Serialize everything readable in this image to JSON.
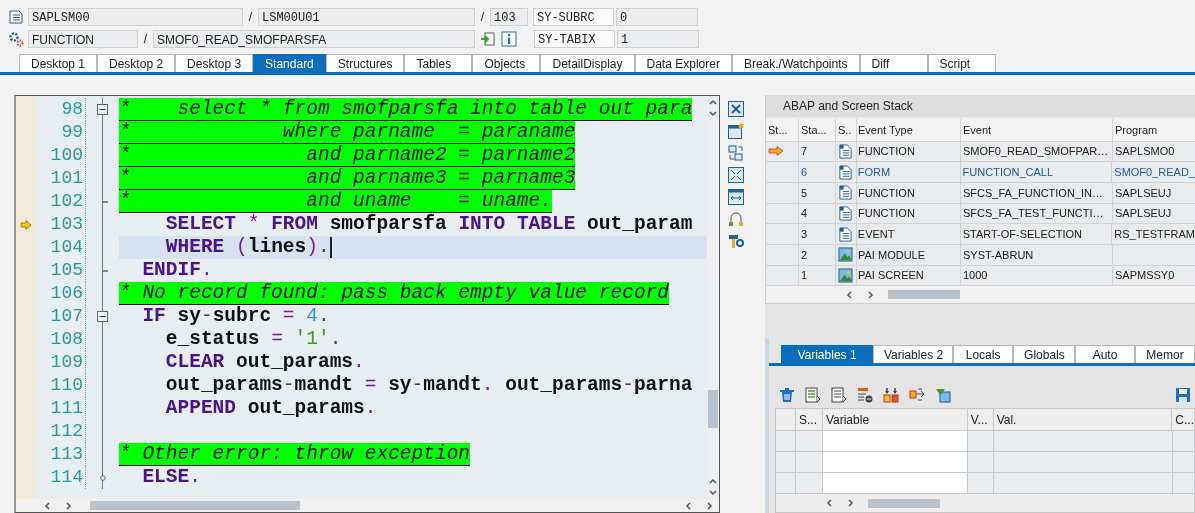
{
  "header": {
    "row1": {
      "program": "SAPLSM00",
      "sep1": "/",
      "include": "LSM00U01",
      "sep2": "/",
      "line": "103",
      "sys_field": "SY-SUBRC",
      "sys_value": "0"
    },
    "row2": {
      "block_type": "FUNCTION",
      "sep1": "/",
      "block_name": "SMOF0_READ_SMOFPARSFA",
      "sys_field": "SY-TABIX",
      "sys_value": "1"
    }
  },
  "desktop_tabs": [
    {
      "label": "Desktop 1",
      "selected": false
    },
    {
      "label": "Desktop 2",
      "selected": false
    },
    {
      "label": "Desktop 3",
      "selected": false
    },
    {
      "label": "Standard",
      "selected": true
    },
    {
      "label": "Structures",
      "selected": false
    },
    {
      "label": "Tables",
      "selected": false
    },
    {
      "label": "Objects",
      "selected": false
    },
    {
      "label": "DetailDisplay",
      "selected": false
    },
    {
      "label": "Data Explorer",
      "selected": false
    },
    {
      "label": "Break./Watchpoints",
      "selected": false
    },
    {
      "label": "Diff",
      "selected": false
    },
    {
      "label": "Script",
      "selected": false
    }
  ],
  "code": {
    "lines": [
      {
        "number": "98",
        "kind": "comment",
        "text": "*    select * from smofparsfa into table out para",
        "fold": {
          "kind": "start"
        },
        "current": false,
        "cursor": false
      },
      {
        "number": "99",
        "kind": "comment",
        "text": "*             where parname  = paraname",
        "current": false,
        "cursor": false
      },
      {
        "number": "100",
        "kind": "comment",
        "text": "*               and parname2 = parname2",
        "current": false,
        "cursor": false
      },
      {
        "number": "101",
        "kind": "comment",
        "text": "*               and parname3 = parname3",
        "current": false,
        "cursor": false
      },
      {
        "number": "102",
        "kind": "comment",
        "text": "*               and uname    = uname.",
        "fold": {
          "kind": "end"
        },
        "current": false,
        "cursor": false
      },
      {
        "number": "103",
        "kind": "code",
        "tokens": [
          {
            "kind": "keyword",
            "text": "    SELECT"
          },
          {
            "kind": "operator",
            "text": " * "
          },
          {
            "kind": "keyword",
            "text": "FROM"
          },
          {
            "kind": "identifier",
            "text": " smofparsfa "
          },
          {
            "kind": "keyword",
            "text": "INTO TABLE"
          },
          {
            "kind": "identifier",
            "text": " out_param"
          }
        ],
        "current": true,
        "cursor": false
      },
      {
        "number": "104",
        "kind": "code",
        "tokens": [
          {
            "kind": "keyword",
            "text": "    WHERE"
          },
          {
            "kind": "operator",
            "text": " ("
          },
          {
            "kind": "identifier",
            "text": "lines"
          },
          {
            "kind": "operator",
            "text": ")."
          }
        ],
        "current": false,
        "cursor": true
      },
      {
        "number": "105",
        "kind": "code",
        "tokens": [
          {
            "kind": "keyword",
            "text": "  ENDIF"
          },
          {
            "kind": "operator",
            "text": "."
          }
        ],
        "fold": {
          "kind": "end"
        },
        "current": false,
        "cursor": false
      },
      {
        "number": "106",
        "kind": "comment",
        "text": "* No record found: pass back empty value record",
        "current": false,
        "cursor": false
      },
      {
        "number": "107",
        "kind": "code",
        "tokens": [
          {
            "kind": "keyword",
            "text": "  IF"
          },
          {
            "kind": "identifier",
            "text": " sy"
          },
          {
            "kind": "operator",
            "text": "-"
          },
          {
            "kind": "identifier",
            "text": "subrc"
          },
          {
            "kind": "operator",
            "text": " = "
          },
          {
            "kind": "number",
            "text": "4"
          },
          {
            "kind": "operator",
            "text": "."
          }
        ],
        "fold": {
          "kind": "start"
        },
        "current": false,
        "cursor": false
      },
      {
        "number": "108",
        "kind": "code",
        "tokens": [
          {
            "kind": "identifier",
            "text": "    e_status"
          },
          {
            "kind": "operator",
            "text": " = "
          },
          {
            "kind": "string",
            "text": "'1'"
          },
          {
            "kind": "operator",
            "text": "."
          }
        ],
        "current": false,
        "cursor": false
      },
      {
        "number": "109",
        "kind": "code",
        "tokens": [
          {
            "kind": "keyword",
            "text": "    CLEAR"
          },
          {
            "kind": "identifier",
            "text": " out_params"
          },
          {
            "kind": "operator",
            "text": "."
          }
        ],
        "current": false,
        "cursor": false
      },
      {
        "number": "110",
        "kind": "code",
        "tokens": [
          {
            "kind": "identifier",
            "text": "    out_params"
          },
          {
            "kind": "operator",
            "text": "-"
          },
          {
            "kind": "identifier",
            "text": "mandt"
          },
          {
            "kind": "operator",
            "text": " = "
          },
          {
            "kind": "identifier",
            "text": "sy"
          },
          {
            "kind": "operator",
            "text": "-"
          },
          {
            "kind": "identifier",
            "text": "mandt"
          },
          {
            "kind": "operator",
            "text": ". "
          },
          {
            "kind": "identifier",
            "text": "out_params"
          },
          {
            "kind": "operator",
            "text": "-"
          },
          {
            "kind": "identifier",
            "text": "parna"
          }
        ],
        "current": false,
        "cursor": false
      },
      {
        "number": "111",
        "kind": "code",
        "tokens": [
          {
            "kind": "keyword",
            "text": "    APPEND"
          },
          {
            "kind": "identifier",
            "text": " out_params"
          },
          {
            "kind": "operator",
            "text": "."
          }
        ],
        "current": false,
        "cursor": false
      },
      {
        "number": "112",
        "kind": "code",
        "current": false,
        "cursor": false
      },
      {
        "number": "113",
        "kind": "comment",
        "text": "* Other error: throw exception",
        "current": false,
        "cursor": false
      },
      {
        "number": "114",
        "kind": "code",
        "tokens": [
          {
            "kind": "keyword",
            "text": "  ELSE"
          },
          {
            "kind": "operator",
            "text": "."
          }
        ],
        "fold": {
          "kind": "branch"
        },
        "current": false,
        "cursor": false
      }
    ]
  },
  "stack": {
    "title": "ABAP and Screen Stack",
    "columns": [
      "St...",
      "Sta...",
      "S..",
      "Event Type",
      "Event",
      "Program"
    ],
    "rows": [
      {
        "no": "7",
        "kind": "program",
        "event_type": "FUNCTION",
        "event": "SMOF0_READ_SMOFPAR…",
        "program": "SAPLSMO0",
        "current": true,
        "selected": false
      },
      {
        "no": "6",
        "kind": "program",
        "event_type": "FORM",
        "event": "FUNCTION_CALL",
        "program": "SMOF0_READ_",
        "current": false,
        "selected": true
      },
      {
        "no": "5",
        "kind": "program",
        "event_type": "FUNCTION",
        "event": "SFCS_FA_FUNCTION_IN…",
        "program": "SAPLSEUJ",
        "current": false,
        "selected": false
      },
      {
        "no": "4",
        "kind": "program",
        "event_type": "FUNCTION",
        "event": "SFCS_FA_TEST_FUNCTI…",
        "program": "SAPLSEUJ",
        "current": false,
        "selected": false
      },
      {
        "no": "3",
        "kind": "program",
        "event_type": "EVENT",
        "event": "START-OF-SELECTION",
        "program": "RS_TESTFRAM",
        "current": false,
        "selected": false
      },
      {
        "no": "2",
        "kind": "screen",
        "event_type": "PAI MODULE",
        "event": "SYST-ABRUN",
        "current": false,
        "selected": false
      },
      {
        "no": "1",
        "kind": "screen",
        "event_type": "PAI SCREEN",
        "event": "1000",
        "program": "SAPMSSY0",
        "current": false,
        "selected": false
      }
    ]
  },
  "variables": {
    "tabs": [
      {
        "label": "Variables 1",
        "selected": true
      },
      {
        "label": "Variables 2",
        "selected": false
      },
      {
        "label": "Locals",
        "selected": false
      },
      {
        "label": "Globals",
        "selected": false
      },
      {
        "label": "Auto",
        "selected": false
      },
      {
        "label": "Memor",
        "selected": false
      }
    ],
    "columns": [
      "S...",
      "Variable",
      "V...",
      "Val.",
      "C..."
    ]
  }
}
